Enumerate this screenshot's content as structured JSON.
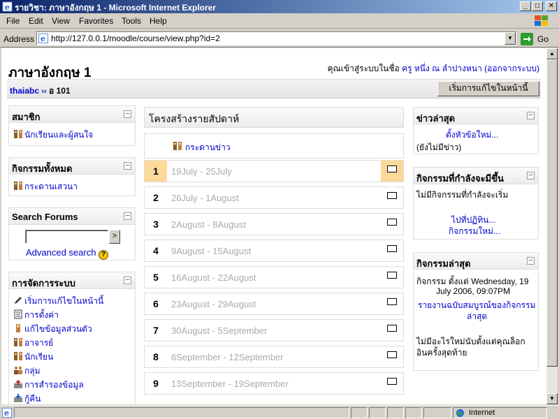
{
  "window": {
    "title": "รายวิชา: ภาษาอังกฤษ 1 - Microsoft Internet Explorer",
    "minimize": "_",
    "maximize": "□",
    "close": "✕"
  },
  "menu": [
    "File",
    "Edit",
    "View",
    "Favorites",
    "Tools",
    "Help"
  ],
  "address": {
    "label": "Address",
    "url": "http://127.0.0.1/moodle/course/view.php?id=2",
    "go": "Go"
  },
  "page": {
    "course_title": "ภาษาอังกฤษ 1",
    "login_prefix": "คุณเข้าสู่ระบบในชื่อ",
    "login_user": "ครู หนึ่ง ณ ลำปางหนา",
    "logout": "(ออกจากระบบ)",
    "breadcrumb_home": "thaiabc",
    "breadcrumb_sep": "››",
    "breadcrumb_course": "อ 101",
    "edit_button": "เริ่มการแก้ไขในหน้านี้"
  },
  "left_blocks": {
    "members": {
      "title": "สมาชิก",
      "items": [
        "นักเรียนและผู้สนใจ"
      ]
    },
    "activities": {
      "title": "กิจกรรมทั้งหมด",
      "items": [
        "กระดานเสวนา"
      ]
    },
    "search": {
      "title": "Search Forums",
      "button": ">",
      "advanced": "Advanced search",
      "help": "?"
    },
    "admin": {
      "title": "การจัดการระบบ",
      "items": [
        "เริ่มการแก้ไขในหน้านี้",
        "การตั้งค่า",
        "แก้ไขข้อมูลส่วนตัว",
        "อาจารย์",
        "นักเรียน",
        "กลุ่ม",
        "การสำรองข้อมูล",
        "กู้คืน"
      ]
    }
  },
  "center": {
    "title": "โครงสร้างรายสัปดาห์",
    "news_forum": "กระดานข่าว",
    "weeks": [
      {
        "num": "1",
        "dates": "19July - 25July",
        "current": true
      },
      {
        "num": "2",
        "dates": "26July - 1August"
      },
      {
        "num": "3",
        "dates": "2August - 8August"
      },
      {
        "num": "4",
        "dates": "9August - 15August"
      },
      {
        "num": "5",
        "dates": "16August - 22August"
      },
      {
        "num": "6",
        "dates": "23August - 29August"
      },
      {
        "num": "7",
        "dates": "30August - 5September"
      },
      {
        "num": "8",
        "dates": "6September - 12September"
      },
      {
        "num": "9",
        "dates": "13September - 19September"
      }
    ]
  },
  "right_blocks": {
    "news": {
      "title": "ข่าวล่าสุด",
      "add": "ตั้งหัวข้อใหม่...",
      "empty": "(ยังไม่มีข่าว)"
    },
    "upcoming": {
      "title": "กิจกรรมที่กำลังจะมีขึ้น",
      "empty": "ไม่มีกิจกรรมที่กำลังจะเริ่ม",
      "calendar": "ไปที่ปฏิทิน...",
      "new_event": "กิจกรรมใหม่..."
    },
    "recent": {
      "title": "กิจกรรมล่าสุด",
      "since_line1": "กิจกรรม ตั้งแต่ Wednesday, 19",
      "since_line2": "July 2006, 09:07PM",
      "full_report_1": "รายงานฉบับสมบูรณ์ของกิจกรรม",
      "full_report_2": "ล่าสุด",
      "nothing_1": "ไม่มีอะไรใหม่นับตั้งแต่คุณล็อก",
      "nothing_2": "อินครั้งสุดท้าย"
    }
  },
  "status": {
    "zone": "Internet"
  },
  "colors": {
    "current_week": "#fcd999",
    "link": "#0000cc",
    "title_bar": "#0a246a"
  }
}
